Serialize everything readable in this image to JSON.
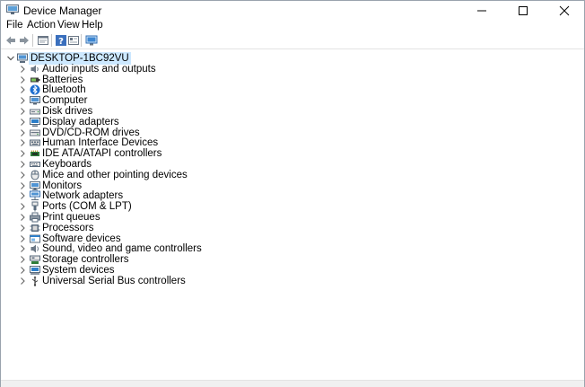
{
  "window": {
    "title": "Device Manager",
    "controls": [
      "minimize",
      "maximize",
      "close"
    ]
  },
  "menu": [
    "File",
    "Action",
    "View",
    "Help"
  ],
  "toolbar": [
    "back-icon",
    "forward-icon",
    "properties-icon",
    "help-icon",
    "view-icon",
    "scan-hardware-icon"
  ],
  "tree": {
    "root": "DESKTOP-1BC92VU",
    "categories": [
      {
        "label": "Audio inputs and outputs",
        "icon": "speaker-icon"
      },
      {
        "label": "Batteries",
        "icon": "battery-icon"
      },
      {
        "label": "Bluetooth",
        "icon": "bluetooth-icon"
      },
      {
        "label": "Computer",
        "icon": "computer-icon"
      },
      {
        "label": "Disk drives",
        "icon": "disk-drive-icon"
      },
      {
        "label": "Display adapters",
        "icon": "display-adapter-icon"
      },
      {
        "label": "DVD/CD-ROM drives",
        "icon": "dvd-drive-icon"
      },
      {
        "label": "Human Interface Devices",
        "icon": "hid-icon"
      },
      {
        "label": "IDE ATA/ATAPI controllers",
        "icon": "ide-controller-icon"
      },
      {
        "label": "Keyboards",
        "icon": "keyboard-icon"
      },
      {
        "label": "Mice and other pointing devices",
        "icon": "mouse-icon"
      },
      {
        "label": "Monitors",
        "icon": "monitor-icon"
      },
      {
        "label": "Network adapters",
        "icon": "network-adapter-icon"
      },
      {
        "label": "Ports (COM & LPT)",
        "icon": "port-icon"
      },
      {
        "label": "Print queues",
        "icon": "printer-icon"
      },
      {
        "label": "Processors",
        "icon": "processor-icon"
      },
      {
        "label": "Software devices",
        "icon": "software-device-icon"
      },
      {
        "label": "Sound, video and game controllers",
        "icon": "sound-controller-icon"
      },
      {
        "label": "Storage controllers",
        "icon": "storage-controller-icon"
      },
      {
        "label": "System devices",
        "icon": "system-device-icon"
      },
      {
        "label": "Universal Serial Bus controllers",
        "icon": "usb-icon"
      }
    ]
  }
}
